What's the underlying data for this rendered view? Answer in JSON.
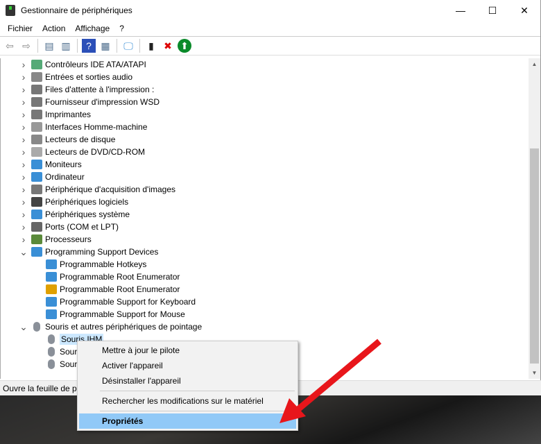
{
  "window": {
    "title": "Gestionnaire de périphériques",
    "controls": [
      "—",
      "☐",
      "✕"
    ]
  },
  "menu": [
    "Fichier",
    "Action",
    "Affichage",
    "?"
  ],
  "toolbar": [
    {
      "icon": "back-icon",
      "g": "⇦"
    },
    {
      "icon": "forward-icon",
      "g": "⇨"
    },
    {
      "icon": "show-hide-console-tree-icon",
      "g": "▤"
    },
    {
      "icon": "properties-icon",
      "g": "▥"
    },
    {
      "icon": "help-icon",
      "g": "?"
    },
    {
      "icon": "action-pane-icon",
      "g": "▦"
    },
    {
      "icon": "scan-hardware-icon",
      "g": "🖵"
    },
    {
      "icon": "update-driver-icon",
      "g": "▮"
    },
    {
      "icon": "uninstall-icon",
      "g": "✖"
    },
    {
      "icon": "enable-device-icon",
      "g": "⬆"
    }
  ],
  "tree": [
    {
      "label": "Contrôleurs IDE ATA/ATAPI",
      "level": 0,
      "state": "collapsed",
      "color": "#5a7"
    },
    {
      "label": "Entrées et sorties audio",
      "level": 0,
      "state": "collapsed",
      "color": "#888"
    },
    {
      "label": "Files d'attente à l'impression :",
      "level": 0,
      "state": "collapsed",
      "color": "#777"
    },
    {
      "label": "Fournisseur d'impression WSD",
      "level": 0,
      "state": "collapsed",
      "color": "#777"
    },
    {
      "label": "Imprimantes",
      "level": 0,
      "state": "collapsed",
      "color": "#777"
    },
    {
      "label": "Interfaces Homme-machine",
      "level": 0,
      "state": "collapsed",
      "color": "#999"
    },
    {
      "label": "Lecteurs de disque",
      "level": 0,
      "state": "collapsed",
      "color": "#888"
    },
    {
      "label": "Lecteurs de DVD/CD-ROM",
      "level": 0,
      "state": "collapsed",
      "color": "#aaa"
    },
    {
      "label": "Moniteurs",
      "level": 0,
      "state": "collapsed",
      "color": "#3a8fd6"
    },
    {
      "label": "Ordinateur",
      "level": 0,
      "state": "collapsed",
      "color": "#3a8fd6"
    },
    {
      "label": "Périphérique d'acquisition d'images",
      "level": 0,
      "state": "collapsed",
      "color": "#777"
    },
    {
      "label": "Périphériques logiciels",
      "level": 0,
      "state": "collapsed",
      "color": "#444"
    },
    {
      "label": "Périphériques système",
      "level": 0,
      "state": "collapsed",
      "color": "#3a8fd6"
    },
    {
      "label": "Ports (COM et LPT)",
      "level": 0,
      "state": "collapsed",
      "color": "#666"
    },
    {
      "label": "Processeurs",
      "level": 0,
      "state": "collapsed",
      "color": "#5a8a3a"
    },
    {
      "label": "Programming Support Devices",
      "level": 0,
      "state": "expanded",
      "color": "#3a8fd6"
    },
    {
      "label": "Programmable Hotkeys",
      "level": 1,
      "color": "#3a8fd6"
    },
    {
      "label": "Programmable Root Enumerator",
      "level": 1,
      "color": "#3a8fd6"
    },
    {
      "label": "Programmable Root Enumerator",
      "level": 1,
      "color": "#e0a000",
      "warning": true
    },
    {
      "label": "Programmable Support for Keyboard",
      "level": 1,
      "color": "#3a8fd6"
    },
    {
      "label": "Programmable Support for Mouse",
      "level": 1,
      "color": "#3a8fd6"
    },
    {
      "label": "Souris et autres périphériques de pointage",
      "level": 0,
      "state": "expanded",
      "color": "#8a9099"
    },
    {
      "label": "Souris IHM",
      "level": 1,
      "color": "#8a9099",
      "selected": true
    },
    {
      "label": "Souris",
      "level": 1,
      "color": "#8a9099"
    },
    {
      "label": "Souris",
      "level": 1,
      "color": "#8a9099"
    }
  ],
  "status": "Ouvre la feuille de propriétés",
  "context_menu": {
    "items": [
      "Mettre à jour le pilote",
      "Activer l'appareil",
      "Désinstaller l'appareil",
      "Rechercher les modifications sur le matériel",
      "Propriétés"
    ],
    "highlighted": "Propriétés"
  },
  "colors": {
    "highlight": "#91c9f7",
    "arrow": "#e8161b",
    "selection": "#cce8ff"
  }
}
